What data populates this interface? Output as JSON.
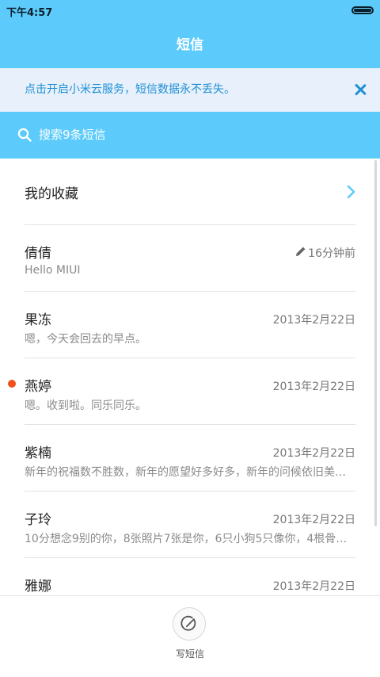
{
  "status_bar": {
    "time": "下午4:57"
  },
  "header": {
    "title": "短信"
  },
  "cloud_banner": {
    "text": "点击开启小米云服务，短信数据永不丢失。"
  },
  "search": {
    "placeholder": "搜索9条短信"
  },
  "favorites": {
    "label": "我的收藏"
  },
  "messages": [
    {
      "name": "倩倩",
      "time": "16分钟前",
      "preview": "Hello MIUI",
      "draft": true,
      "unread": false
    },
    {
      "name": "果冻",
      "time": "2013年2月22日",
      "preview": "嗯，今天会回去的早点。",
      "unread": false
    },
    {
      "name": "燕婷",
      "time": "2013年2月22日",
      "preview": "嗯。收到啦。同乐同乐。",
      "unread": true
    },
    {
      "name": "紫楠",
      "time": "2013年2月22日",
      "preview": "新年的祝福数不胜数，新年的愿望好多好多，新年的问候依旧美…",
      "unread": false
    },
    {
      "name": "子玲",
      "time": "2013年2月22日",
      "preview": "10分想念9别的你，8张照片7张是你，6只小狗5只像你，4根骨…",
      "unread": false
    },
    {
      "name": "雅娜",
      "time": "2013年2月22日",
      "preview": "",
      "unread": false
    }
  ],
  "compose": {
    "label": "写短信"
  },
  "colors": {
    "accent": "#5ccbfb",
    "banner_bg": "#e8f1fb",
    "banner_text": "#1f8fd6",
    "unread_dot": "#f2501c"
  },
  "icons": [
    "search-icon",
    "close-icon",
    "chevron-right-icon",
    "pencil-icon",
    "compose-icon",
    "battery-icon"
  ]
}
